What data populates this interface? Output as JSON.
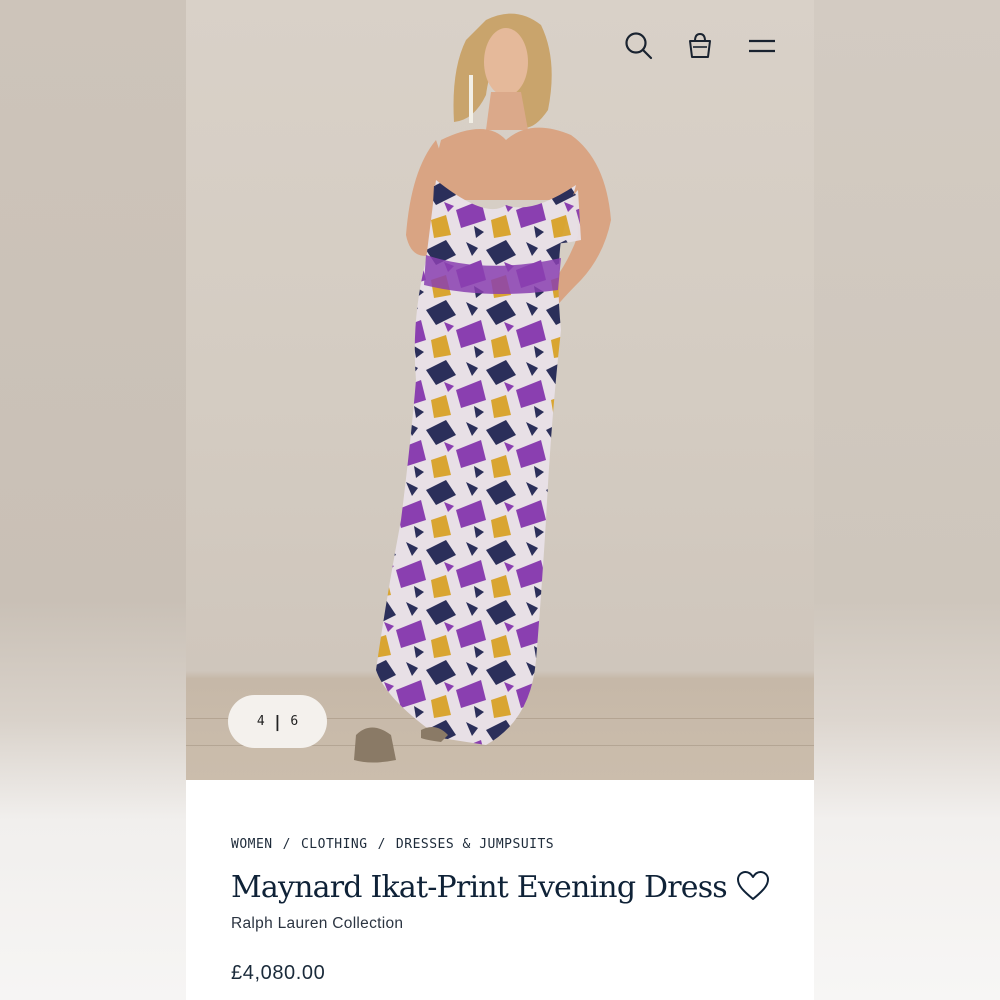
{
  "header": {
    "icons": [
      "search-icon",
      "shopping-bag-icon",
      "hamburger-menu-icon"
    ]
  },
  "gallery": {
    "current": "4",
    "total": "6",
    "separator": "|"
  },
  "breadcrumb": [
    {
      "label": "WOMEN"
    },
    {
      "label": "CLOTHING"
    },
    {
      "label": "DRESSES & JUMPSUITS"
    }
  ],
  "breadcrumb_separator": "/",
  "product": {
    "title": "Maynard Ikat-Print Evening Dress",
    "brand": "Ralph Lauren Collection",
    "price": "£4,080.00"
  },
  "colors": {
    "navy": "#0f2237",
    "pill": "#f4f1ed",
    "wall": "#d9d1c8",
    "dress_purple": "#8a3fb0",
    "dress_navy": "#2b2f5a",
    "dress_yellow": "#d9a531"
  }
}
